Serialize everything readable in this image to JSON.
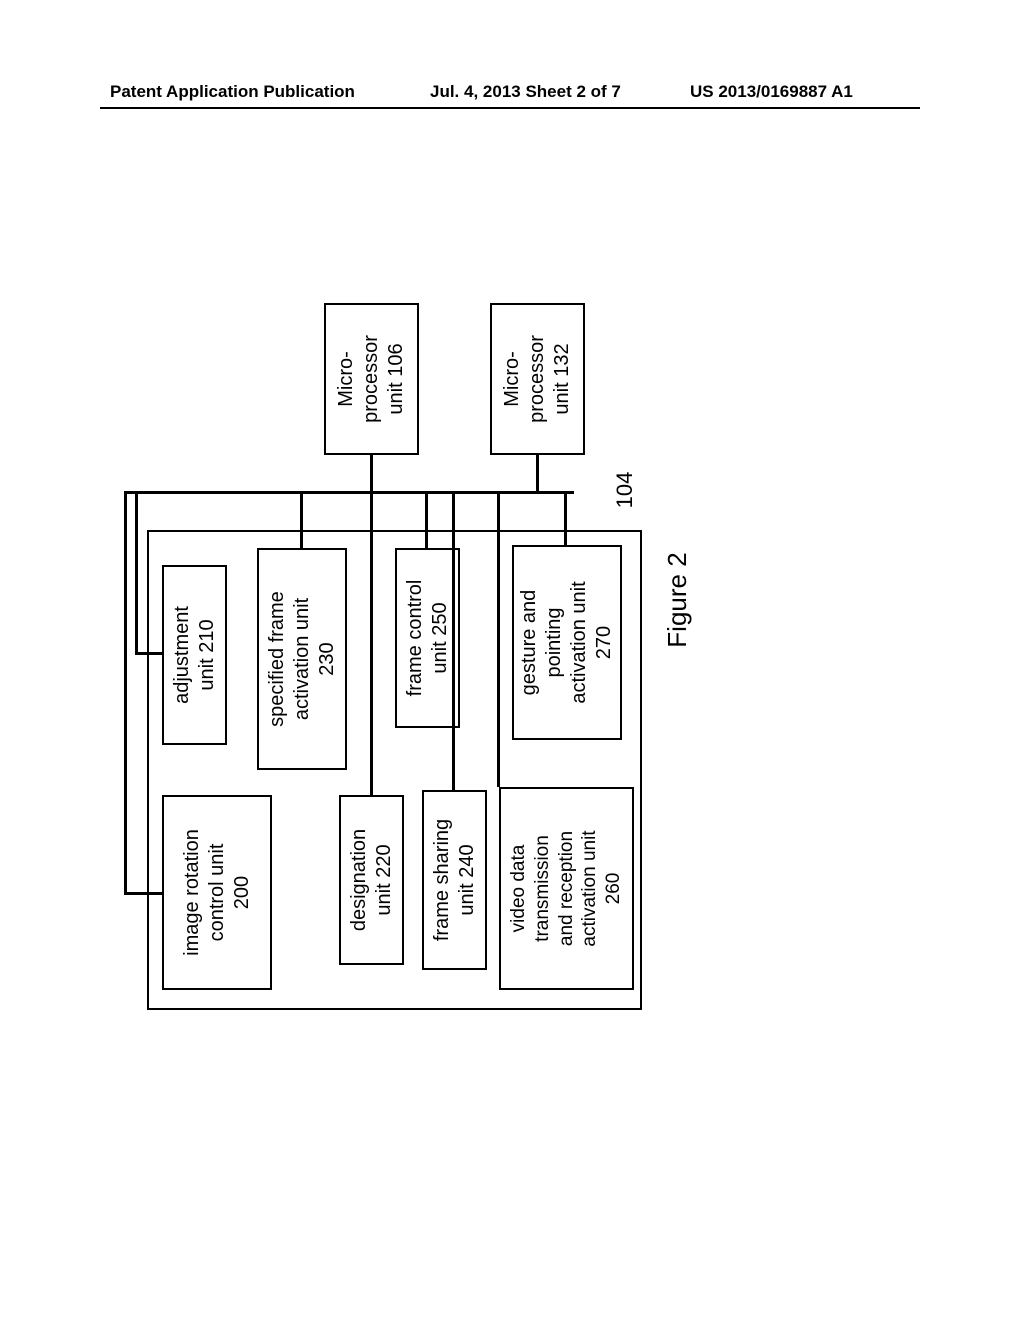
{
  "header": {
    "left": "Patent Application Publication",
    "center": "Jul. 4, 2013   Sheet 2 of 7",
    "right": "US 2013/0169887 A1"
  },
  "diagram": {
    "figure_label": "Figure 2",
    "container_ref": "104",
    "blocks": {
      "image_rotation": "image rotation\ncontrol unit\n200",
      "adjustment": "adjustment\nunit 210",
      "designation": "designation\nunit 220",
      "specified_frame": "specified frame\nactivation unit\n230",
      "frame_sharing": "frame sharing\nunit 240",
      "frame_control": "frame control\nunit 250",
      "video_data": "video data\ntransmission\nand reception\nactivation unit\n260",
      "gesture_pointing": "gesture and\npointing\nactivation unit\n270",
      "micro_106": "Micro-\nprocessor\nunit  106",
      "micro_132": "Micro-\nprocessor\nunit 132"
    }
  }
}
